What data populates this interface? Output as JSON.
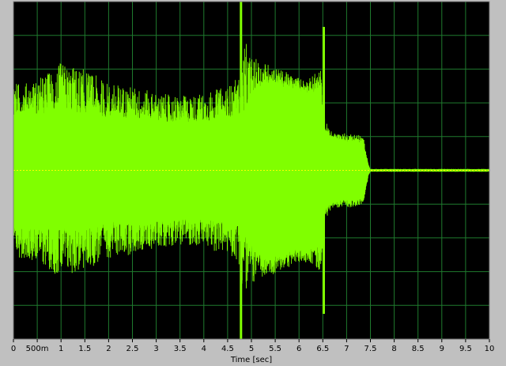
{
  "chart_data": {
    "type": "line",
    "title": "",
    "xlabel": "Time [sec]",
    "ylabel": "",
    "xlim": [
      0,
      10
    ],
    "ylim": [
      -1,
      1
    ],
    "grid": true,
    "legend": "none",
    "x_tick_values": [
      0,
      0.5,
      1,
      1.5,
      2,
      2.5,
      3,
      3.5,
      4,
      4.5,
      5,
      5.5,
      6,
      6.5,
      7,
      7.5,
      8,
      8.5,
      9,
      9.5,
      10
    ],
    "x_tick_labels": [
      "0",
      "500m",
      "1",
      "1.5",
      "2",
      "2.5",
      "3",
      "3.5",
      "4",
      "4.5",
      "5",
      "5.5",
      "6",
      "6.5",
      "7",
      "7.5",
      "8",
      "8.5",
      "9",
      "9.5",
      "10"
    ],
    "y_gridlines": [
      -1,
      -0.8,
      -0.6,
      -0.4,
      -0.2,
      0,
      0.2,
      0.4,
      0.6,
      0.8,
      1
    ],
    "series": [
      {
        "kind": "envelope",
        "color": "#80ff00",
        "t": [
          0.0,
          0.25,
          0.5,
          1.0,
          1.5,
          2.0,
          2.5,
          3.0,
          3.5,
          4.0,
          4.5,
          4.75,
          4.85,
          5.0,
          5.3,
          5.6,
          5.9,
          6.2,
          6.45,
          6.55,
          6.7,
          7.0,
          7.2,
          7.35,
          7.45,
          7.5,
          8.0,
          9.0,
          10.0
        ],
        "bulk": [
          0.32,
          0.33,
          0.33,
          0.34,
          0.33,
          0.3,
          0.31,
          0.29,
          0.28,
          0.29,
          0.31,
          0.32,
          0.34,
          0.44,
          0.52,
          0.5,
          0.47,
          0.46,
          0.45,
          0.22,
          0.19,
          0.17,
          0.17,
          0.16,
          0.04,
          0.008,
          0.008,
          0.008,
          0.008
        ],
        "peak": [
          0.52,
          0.52,
          0.54,
          0.64,
          0.6,
          0.52,
          0.5,
          0.46,
          0.44,
          0.46,
          0.5,
          0.56,
          0.78,
          0.67,
          0.64,
          0.6,
          0.56,
          0.54,
          0.61,
          0.3,
          0.22,
          0.22,
          0.22,
          0.2,
          0.05,
          0.01,
          0.01,
          0.01,
          0.01
        ],
        "spikes": [
          {
            "t": 4.78,
            "a": 1.0
          },
          {
            "t": 6.52,
            "a": 0.85
          }
        ]
      }
    ],
    "dc_line": {
      "y": 0,
      "color": "#ffff00"
    }
  }
}
